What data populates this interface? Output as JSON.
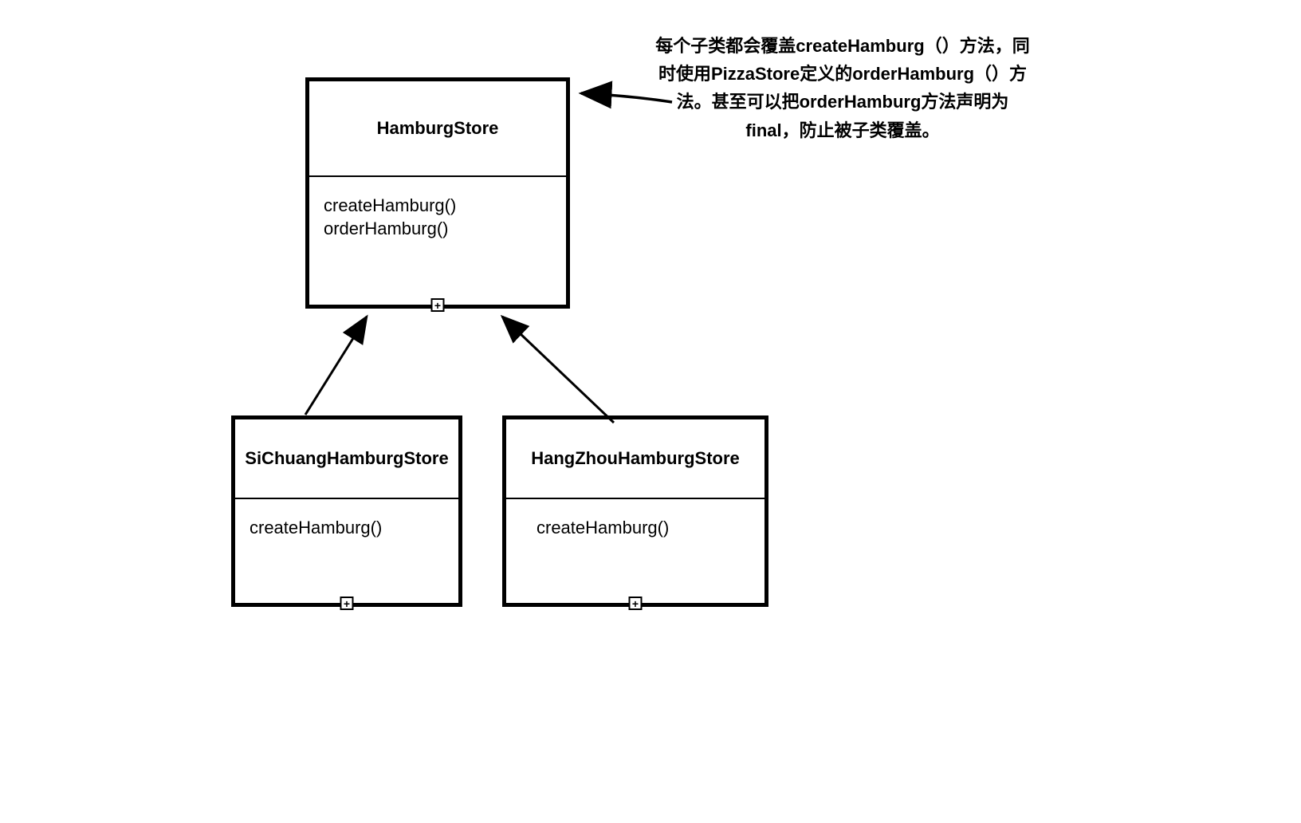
{
  "parent_class": {
    "name": "HamburgStore",
    "methods": [
      "createHamburg()",
      "orderHamburg()"
    ]
  },
  "child_classes": [
    {
      "name": "SiChuangHamburgStore",
      "methods": [
        "createHamburg()"
      ]
    },
    {
      "name": "HangZhouHamburgStore",
      "methods": [
        "createHamburg()"
      ]
    }
  ],
  "annotation": "每个子类都会覆盖createHamburg（）方法，同时使用PizzaStore定义的orderHamburg（）方法。甚至可以把orderHamburg方法声明为final，防止被子类覆盖。",
  "plus_symbol": "+"
}
